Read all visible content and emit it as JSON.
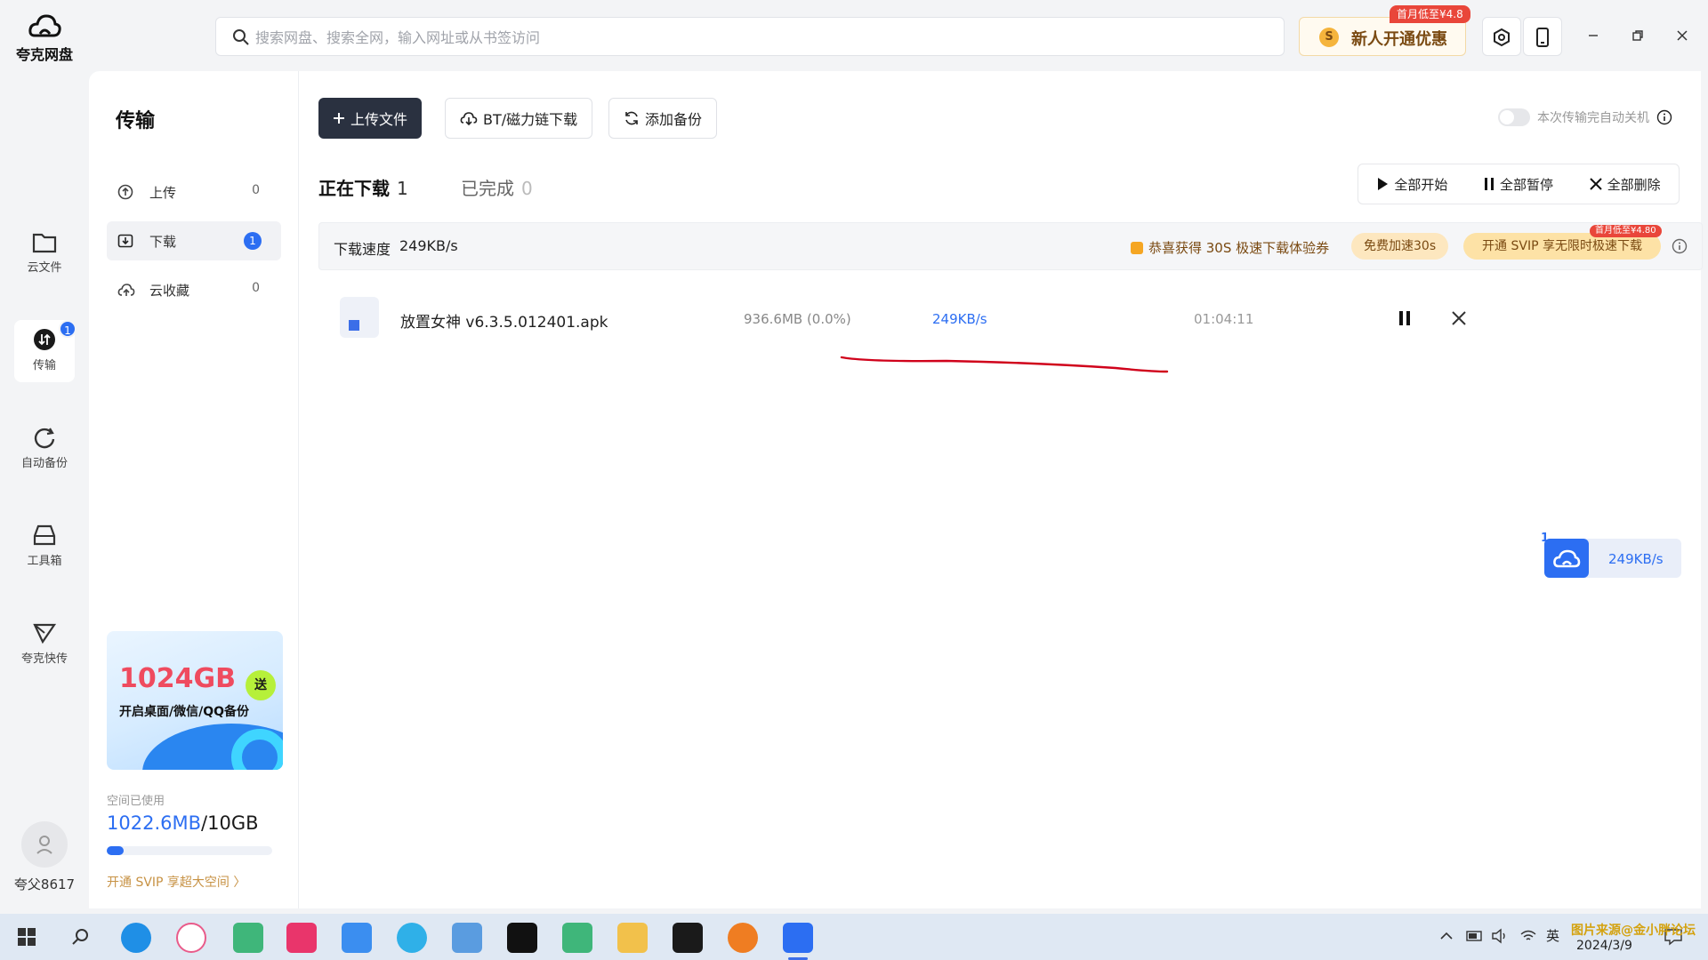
{
  "app": {
    "logo_text": "夸克网盘"
  },
  "rail": {
    "items": [
      {
        "label": "云文件",
        "icon": "folder-icon"
      },
      {
        "label": "传输",
        "icon": "transfer-icon",
        "badge": "1"
      },
      {
        "label": "自动备份",
        "icon": "backup-icon"
      },
      {
        "label": "工具箱",
        "icon": "toolbox-icon"
      },
      {
        "label": "夸克快传",
        "icon": "send-icon"
      }
    ],
    "username": "夸父8617"
  },
  "search": {
    "placeholder": "搜索网盘、搜索全网，输入网址或从书签访问"
  },
  "promo": {
    "label": "新人开通优惠",
    "tag": "首月低至¥4.8",
    "coin": "S"
  },
  "panel": {
    "title": "传输",
    "items": [
      {
        "label": "上传",
        "count": "0"
      },
      {
        "label": "下载",
        "count": "1"
      },
      {
        "label": "云收藏",
        "count": "0"
      }
    ],
    "banner": {
      "big": "1024GB",
      "send": "送",
      "sub": "开启桌面/微信/QQ备份"
    },
    "storage": {
      "label": "空间已使用",
      "used": "1022.6MB",
      "sep": "/",
      "total": "10GB",
      "fraction": 0.1
    },
    "svip_link": "开通 SVIP 享超大空间 〉"
  },
  "toolbar": {
    "upload": "上传文件",
    "bt": "BT/磁力链下载",
    "backup": "添加备份",
    "auto_shutdown": "本次传输完自动关机"
  },
  "tabs": [
    {
      "label": "正在下载",
      "count": "1"
    },
    {
      "label": "已完成",
      "count": "0"
    }
  ],
  "bulk": {
    "start_all": "全部开始",
    "pause_all": "全部暂停",
    "delete_all": "全部删除"
  },
  "speedbar": {
    "label": "下载速度",
    "value": "249KB/s",
    "coupon": "恭喜获得 30S 极速下载体验券",
    "free_btn": "免费加速30s",
    "svip_btn": "开通 SVIP 享无限时极速下载",
    "svip_tag": "首月低至¥4.80"
  },
  "downloads": [
    {
      "name": "放置女神 v6.3.5.012401.apk",
      "size": "936.6MB (0.0%)",
      "speed": "249KB/s",
      "eta": "01:04:11"
    }
  ],
  "float_widget": {
    "count": "1",
    "speed": "249KB/s"
  },
  "taskbar": {
    "ime": "英",
    "date": "2024/3/9",
    "watermark": "图片来源@金小胖论坛"
  },
  "colors": {
    "accent": "#2c6ef2",
    "primary_button": "#2a3140",
    "vip": "#fde2a6",
    "annotation": "#d0021b"
  }
}
